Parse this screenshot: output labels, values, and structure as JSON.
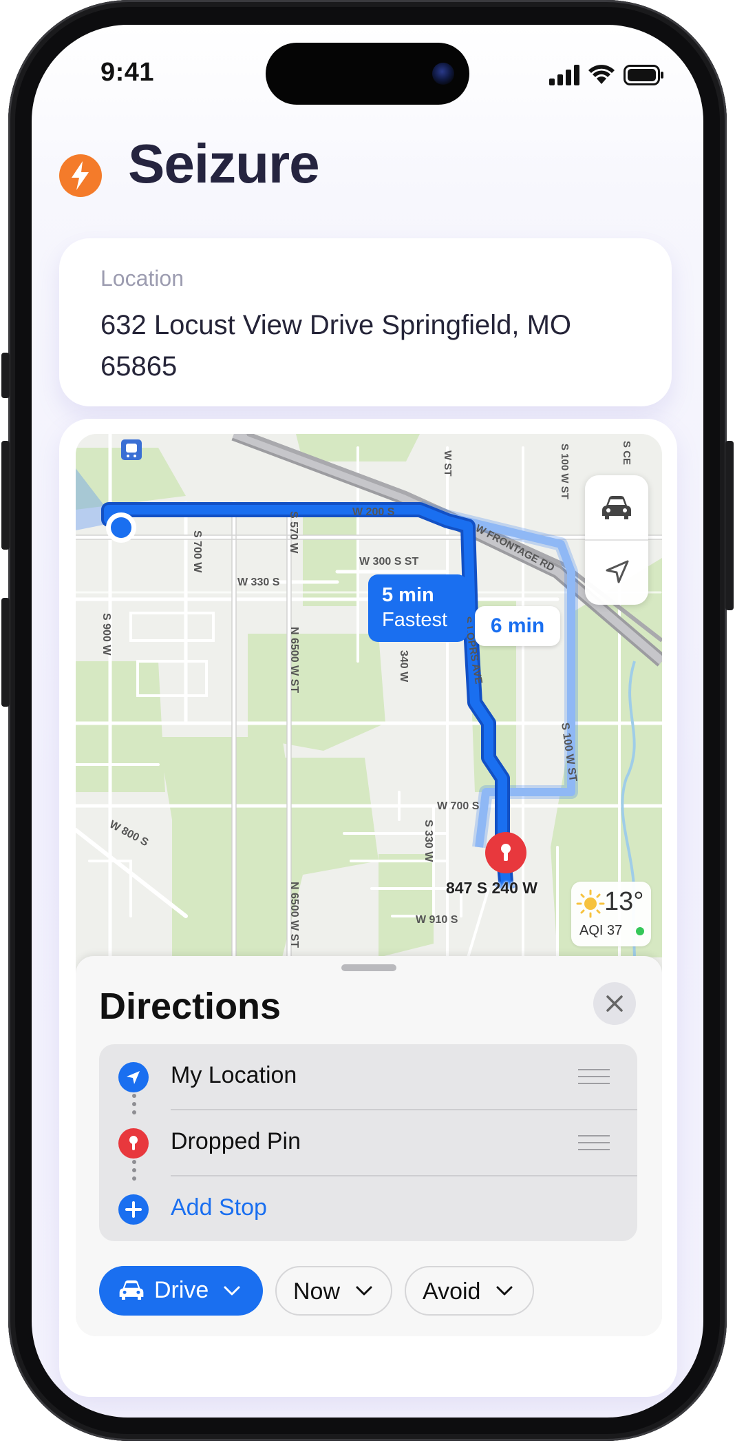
{
  "status_bar": {
    "time": "9:41"
  },
  "app": {
    "title": "Seizure"
  },
  "location": {
    "label": "Location",
    "address": "632 Locust View Drive Springfield, MO 65865"
  },
  "map": {
    "streets": {
      "w200s": "W 200 S",
      "w300sst": "W 300 S ST",
      "w330s": "W 330 S",
      "frontage": "W FRONTAGE RD",
      "s700w": "S 700 W",
      "s570w": "S 570 W",
      "s900w": "S 900 W",
      "n6500wst_top": "N 6500 W ST",
      "n6500wst_bottom": "N 6500 W ST",
      "sloprsave": "S LOPRS AVE",
      "s340w": "340 W",
      "s100wst_top": "S 100 W ST",
      "s100wst_mid": "S 100 W ST",
      "w700s": "W 700 S",
      "w800s": "W 800 S",
      "s330w": "S 330 W",
      "w910s": "W 910 S",
      "wst": "W ST",
      "sce": "S CE"
    },
    "route_fastest": {
      "time": "5 min",
      "tag": "Fastest"
    },
    "route_alternate": {
      "time": "6 min"
    },
    "destination_label": "847 S 240 W",
    "weather": {
      "temp": "13°",
      "aqi": "AQI 37"
    },
    "colors": {
      "route": "#1a6ff0",
      "route_alt": "#8fb8f5",
      "park": "#d6e8c2",
      "pin": "#e8383d"
    },
    "icons": {
      "drive_mode": "car-icon",
      "location": "location-arrow-icon",
      "transit": "train-icon"
    }
  },
  "directions": {
    "title": "Directions",
    "stops": [
      {
        "label": "My Location",
        "icon": "location-arrow-icon"
      },
      {
        "label": "Dropped Pin",
        "icon": "pin-icon"
      },
      {
        "label": "Add Stop",
        "icon": "plus-icon"
      }
    ],
    "options": {
      "mode": "Drive",
      "time": "Now",
      "avoid": "Avoid"
    }
  }
}
